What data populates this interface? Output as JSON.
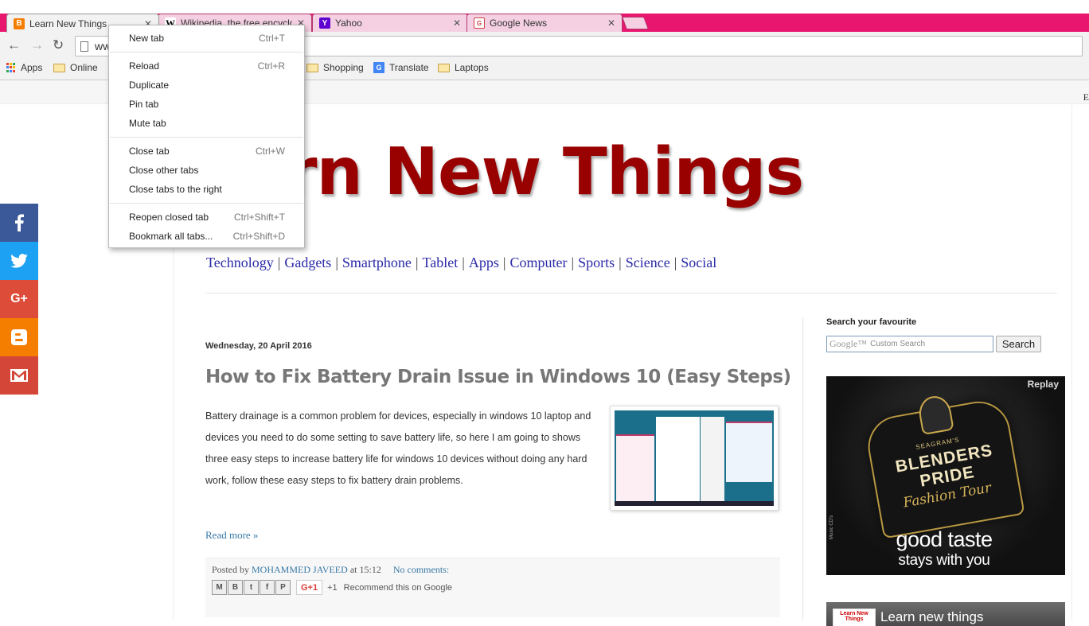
{
  "browser": {
    "tabs": [
      {
        "title": "Learn New Things",
        "active": true
      },
      {
        "title": "Wikipedia, the free encyclopedia",
        "active": false
      },
      {
        "title": "Yahoo",
        "active": false
      },
      {
        "title": "Google News",
        "active": false
      }
    ],
    "close_glyph": "✕",
    "address": "www",
    "bookmarks": [
      {
        "label": "Apps",
        "icon": "apps-grid-icon"
      },
      {
        "label": "Online",
        "icon": "folder-icon"
      },
      {
        "label": "Shopping",
        "icon": "folder-icon"
      },
      {
        "label": "Translate",
        "icon": "translate-icon"
      },
      {
        "label": "Laptops",
        "icon": "folder-icon"
      }
    ]
  },
  "context_menu": {
    "groups": [
      [
        {
          "label": "New tab",
          "shortcut": "Ctrl+T"
        }
      ],
      [
        {
          "label": "Reload",
          "shortcut": "Ctrl+R"
        },
        {
          "label": "Duplicate",
          "shortcut": ""
        },
        {
          "label": "Pin tab",
          "shortcut": ""
        },
        {
          "label": "Mute tab",
          "shortcut": ""
        }
      ],
      [
        {
          "label": "Close tab",
          "shortcut": "Ctrl+W"
        },
        {
          "label": "Close other tabs",
          "shortcut": ""
        },
        {
          "label": "Close tabs to the right",
          "shortcut": ""
        }
      ],
      [
        {
          "label": "Reopen closed tab",
          "shortcut": "Ctrl+Shift+T"
        },
        {
          "label": "Bookmark all tabs...",
          "shortcut": "Ctrl+Shift+D"
        }
      ]
    ]
  },
  "blog": {
    "title_visible": "rn New Things",
    "nav": [
      "Technology",
      "Gadgets",
      "Smartphone",
      "Tablet",
      "Apps",
      "Computer",
      "Sports",
      "Science",
      "Social"
    ],
    "nav_separator": "|",
    "date_header": "Wednesday, 20 April 2016",
    "post_title": "How to Fix Battery Drain Issue in Windows 10 (Easy Steps)",
    "post_body": "Battery drainage is a common problem for devices, especially in windows 10 laptop and devices you need to do some setting to save battery life, so here I am going to shows three easy steps to increase battery life for windows 10 devices without doing any hard work, follow these easy steps to fix battery drain problems.",
    "read_more": "Read more »",
    "posted_by": "Posted by",
    "author": "MOHAMMED JAVEED",
    "at": "at",
    "time": "15:12",
    "comments": "No comments:",
    "share_icons": [
      "email-icon",
      "blogger-icon",
      "twitter-icon",
      "facebook-icon",
      "pinterest-icon"
    ],
    "gplus": "G+1",
    "plus_one": "+1",
    "recommend": "Recommend this on Google",
    "edge_char": "E"
  },
  "sidebar": {
    "search_title": "Search your favourite",
    "search_placeholder_brand": "Google™",
    "search_placeholder": "Custom Search",
    "search_button": "Search",
    "ad": {
      "replay": "Replay",
      "brand_small": "SEAGRAM'S",
      "brand_line1": "BLENDERS",
      "brand_line2": "PRIDE",
      "script": "Fashion Tour",
      "tagline1": "good taste",
      "tagline2": "stays with you",
      "side_note": "Music CD's"
    },
    "widget2_text": "Learn new things",
    "widget2_logo": "Learn New Things"
  },
  "social": [
    {
      "name": "facebook",
      "color": "#3b5998"
    },
    {
      "name": "twitter",
      "color": "#1da1f2"
    },
    {
      "name": "google-plus",
      "color": "#dd4b39"
    },
    {
      "name": "blogger",
      "color": "#f57d00"
    },
    {
      "name": "gmail",
      "color": "#d44638"
    }
  ],
  "colors": {
    "tabstrip": "#e8166f",
    "title": "#990000",
    "link": "#3778a6",
    "nav_link": "#2a2aa8"
  }
}
